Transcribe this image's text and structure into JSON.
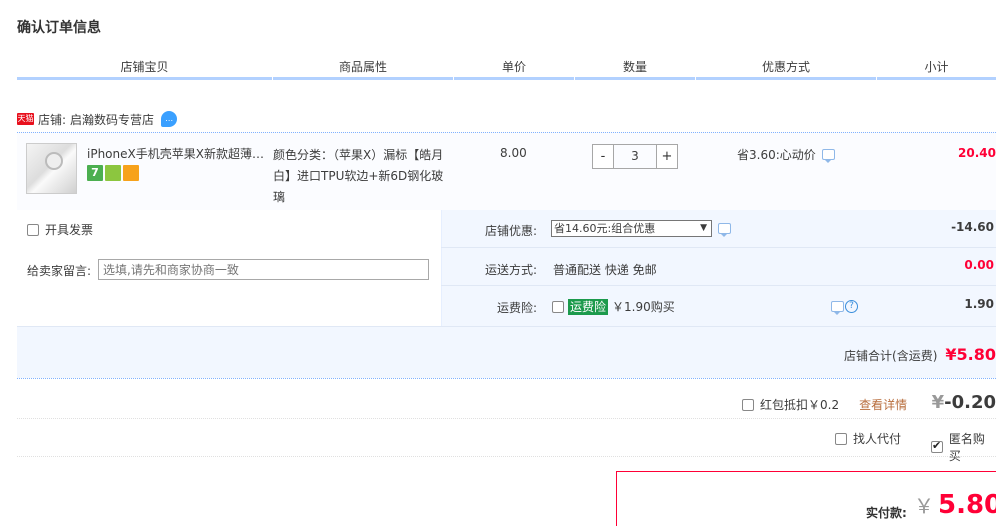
{
  "title": "确认订单信息",
  "columns": [
    "店铺宝贝",
    "商品属性",
    "单价",
    "数量",
    "优惠方式",
    "小计"
  ],
  "shop": {
    "tmall_badge": "天猫",
    "label": "店铺:",
    "name": "启瀚数码专营店"
  },
  "item": {
    "name": "iPhoneX手机壳苹果X新款超薄玻璃...",
    "attr_line1": "颜色分类：（苹果X）漏标【皓月",
    "attr_line2": "白】进口TPU软边+新6D钢化玻璃",
    "price": "8.00",
    "qty_minus": "-",
    "qty": "3",
    "qty_plus": "+",
    "promo": "省3.60:心动价",
    "subtotal": "20.40",
    "service_badge": "7"
  },
  "options": {
    "invoice_label": "开具发票",
    "message_label": "给卖家留言:",
    "message_placeholder": "选填,请先和商家协商一致",
    "shop_discount_label": "店铺优惠:",
    "shop_discount_selected": "省14.60元:组合优惠",
    "shop_discount_value": "-14.60",
    "shipping_label": "运送方式:",
    "shipping_value": "普通配送 快递 免邮",
    "shipping_price": "0.00",
    "insurance_label": "运费险:",
    "insurance_badge": "运费险",
    "insurance_text": "￥1.90购买",
    "insurance_price": "1.90",
    "shop_total_label": "店铺合计(含运费)",
    "shop_total": "¥5.80"
  },
  "red_packet": {
    "label": "红包抵扣￥0.2",
    "link": "查看详情",
    "yen": "¥",
    "amount": "-0.20"
  },
  "proxy_label": "找人代付",
  "anon_label": "匿名购买",
  "pay": {
    "label": "实付款:",
    "yen": "￥",
    "amount": "5.80"
  },
  "colors": {
    "accent_red": "#ff0036",
    "header_line": "#b2d1ff",
    "option_bg": "#f2f7ff",
    "insurance_green": "#1c9a4c"
  }
}
